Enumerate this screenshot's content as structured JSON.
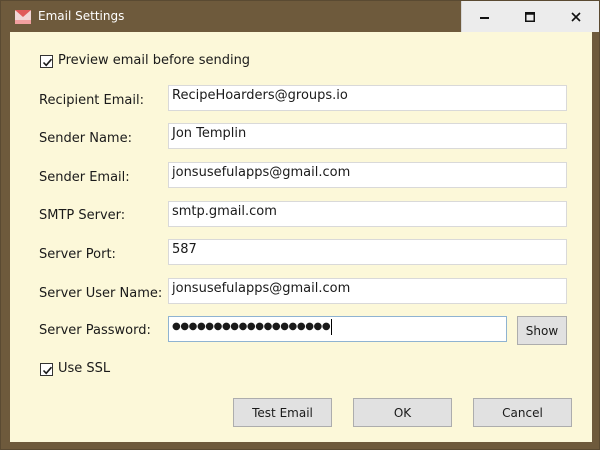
{
  "window": {
    "title": "Email Settings"
  },
  "form": {
    "preview_label": "Preview email before sending",
    "preview_checked": true,
    "fields": [
      {
        "label": "Recipient Email:",
        "value": "RecipeHoarders@groups.io"
      },
      {
        "label": "Sender Name:",
        "value": "Jon Templin"
      },
      {
        "label": "Sender Email:",
        "value": "jonsusefulapps@gmail.com"
      },
      {
        "label": "SMTP Server:",
        "value": "smtp.gmail.com"
      },
      {
        "label": "Server Port:",
        "value": "587"
      },
      {
        "label": "Server User Name:",
        "value": "jonsusefulapps@gmail.com"
      }
    ],
    "password": {
      "label": "Server Password:",
      "masked_value": "●●●●●●●●●●●●●●●●●●●",
      "show_button": "Show"
    },
    "ssl_label": "Use SSL",
    "ssl_checked": true
  },
  "buttons": {
    "test_email": "Test Email",
    "ok": "OK",
    "cancel": "Cancel"
  },
  "colors": {
    "frame": "#6e5a3c",
    "client_background": "#fcf8d9",
    "button_face": "#e1e1e1",
    "caption_buttons": "#ececec"
  }
}
